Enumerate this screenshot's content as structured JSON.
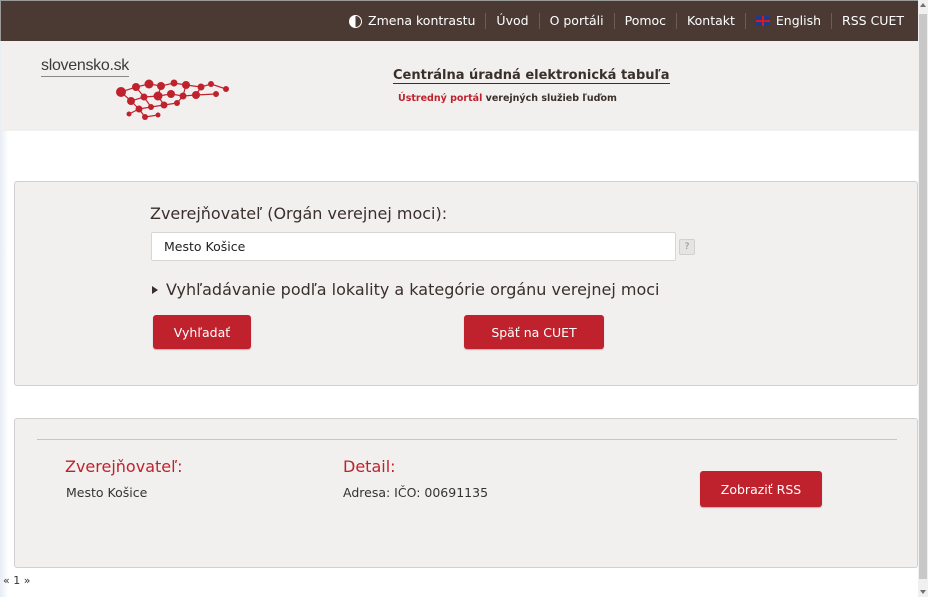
{
  "topnav": {
    "contrast": "Zmena kontrastu",
    "intro": "Úvod",
    "about": "O portáli",
    "help": "Pomoc",
    "contact": "Kontakt",
    "english": "English",
    "rss": "RSS CUET"
  },
  "header": {
    "logo_text": "slovensko.sk",
    "title": "Centrálna úradná elektronická tabuľa",
    "subtitle_red": "Ústredný portál",
    "subtitle_rest": " verejných služieb ľuďom"
  },
  "search": {
    "label": "Zverejňovateľ (Orgán verejnej moci):",
    "value": "Mesto Košice",
    "help": "?",
    "expander": "Vyhľadávanie podľa lokality a kategórie orgánu verejnej moci",
    "search_button": "Vyhľadať",
    "back_button": "Späť na CUET"
  },
  "result": {
    "publisher_label": "Zverejňovateľ:",
    "publisher_value": "Mesto Košice",
    "detail_label": "Detail:",
    "detail_value": "Adresa: IČO: 00691135",
    "rss_button": "Zobraziť RSS"
  },
  "pager": "« 1 »",
  "colors": {
    "topbar": "#4a3a33",
    "accent": "#c0222d",
    "panel": "#f1f0ef"
  },
  "icons": [
    "contrast-icon",
    "uk-flag-icon",
    "slovensko-logo"
  ]
}
